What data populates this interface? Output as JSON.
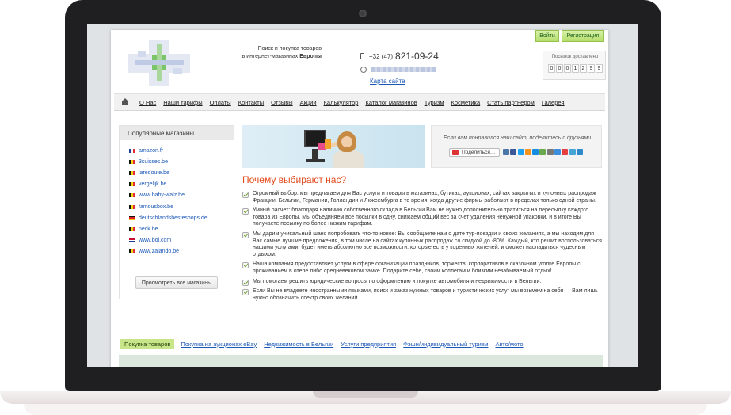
{
  "header": {
    "tagline_line1": "Поиск и покупка товаров",
    "tagline_line2_prefix": "в интернет-магазинах ",
    "tagline_line2_bold": "Европы",
    "phone_code": "+32 (47)",
    "phone_number": "821-09-24",
    "map_link": "Карта сайта",
    "login_label": "Войти",
    "register_label": "Регистрация",
    "counter_label": "Посылок доставлено",
    "counter_digits": [
      "0",
      "0",
      "0",
      "1",
      "2",
      "9",
      "9"
    ]
  },
  "nav": {
    "items": [
      "О Нас",
      "Наши тарифы",
      "Оплаты",
      "Контакты",
      "Отзывы",
      "Акции",
      "Калькулятор",
      "Каталог магазинов",
      "Туризм",
      "Косметика",
      "Стать партнером",
      "Галерея"
    ]
  },
  "sidebar": {
    "title": "Популярные магазины",
    "shops": [
      {
        "name": "amazon.fr",
        "flag": "fr"
      },
      {
        "name": "3suisses.be",
        "flag": "be"
      },
      {
        "name": "laredoute.be",
        "flag": "be"
      },
      {
        "name": "vergelijk.be",
        "flag": "be"
      },
      {
        "name": "www.baby-walz.be",
        "flag": "be"
      },
      {
        "name": "famousbox.be",
        "flag": "be"
      },
      {
        "name": "deutschlandsbesteshops.de",
        "flag": "de"
      },
      {
        "name": "neck.be",
        "flag": "be"
      },
      {
        "name": "www.bol.com",
        "flag": "nl"
      },
      {
        "name": "www.zalando.be",
        "flag": "be"
      }
    ],
    "all_shops_button": "Просмотреть все магазины"
  },
  "share": {
    "text": "Если вам понравился наш сайт, поделитесь с друзьями",
    "button_label": "Поделиться…"
  },
  "main": {
    "title": "Почему выбирают нас?",
    "reasons": [
      "Огромный выбор: мы предлагаем для Вас услуги и товары в магазинах, бутиках, аукционах, сайтах закрытых и купонных распродаж Франции, Бельгии, Германии, Голландии и Люксембурга в то время, когда другие фирмы работают в пределах только одной страны.",
      "Умный расчет: благодаря наличию собственного склада в Бельгии Вам не нужно дополнительно тратиться на пересылку каждого товара из Европы. Мы объединяем все посылки в одну, снижаем общий вес за счет удаления ненужной упаковки, и в итоге Вы получаете посылку по более низким тарифам.",
      "Мы дарим уникальный шанс попробовать что-то новое: Вы сообщаете нам о дате тур-поездки и своих желаниях, а мы находим для Вас самые лучшие предложения, в том числе на сайтах купонных распродаж со скидкой до -80%. Каждый, кто решит воспользоваться нашими услугами, будет иметь абсолютно все возможности, которые есть у коренных жителей, и сможет насладиться чудесным отдыхом.",
      " Наша компания предоставляет услуги в сфере организации праздников, торжеств, корпоративов в сказочном уголке Европы с проживанием в отеле либо средневековом замке. Подарите себе, своим коллегам и близким незабываемый отдых!",
      "Мы помогаем решить юридические вопросы по оформлению и покупке автомобиля и недвижимости в Бельгии.",
      "Если Вы не владеете иностранными языками, поиск и заказ нужных товаров и туристических услуг мы возьмем на себя — Вам лишь нужно обозначить спектр своих желаний."
    ]
  },
  "tabs": {
    "items": [
      "Покупка товаров",
      "Покупка на аукционах eBay",
      "Недвижимость в Бельгии",
      "Услуги предприятия",
      "Фэшн/индивидуальный туризм",
      "Авто/мото"
    ],
    "active_index": 0
  },
  "colors": {
    "accent_orange": "#e24a1c",
    "link_blue": "#1b58b8",
    "button_green": "#b4de6c"
  }
}
